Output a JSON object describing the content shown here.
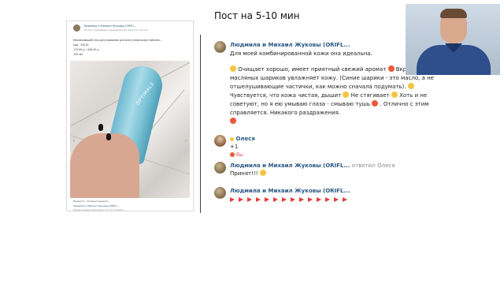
{
  "slide": {
    "title": "Пост на 5-10 мин"
  },
  "post": {
    "author": "Людмила и Михаил Жуковы (ORIFL...",
    "location": "16 ноя. | Меридиан (Свердловская область), Россия",
    "text_line1": "Увлажняющий гель для умывания для всех типов кожи Optimals...",
    "text_line2": "код - 32410",
    "text_line3": "179,90 р. / 449,00 р.",
    "text_line4": "155 зет",
    "brand": "OPTIMALS",
    "footer_line1": "Нравится · Комментировать",
    "footer_line2": "Людмила и Михаил Жуковы (ORIFL...",
    "footer_line3": "Предложение действует по 27.10.2019 г."
  },
  "comments": [
    {
      "author": "Людмила и Михаил Жуковы (ORIFL...",
      "lines": [
        "Для моей комбинированной кожи она идеальна.",
        "Очищает хорошо, имеет приятный свежий аромат",
        "масляных шариков увлажняет кожу. (Синие шарики - это масло, а не",
        "отшелушивающие частички, как можно сначала подумать).",
        "Чувствуется, что кожа чистая, дышит",
        "советуют, но я ею умываю глаза - смываю тушь",
        "справляется. Никакого раздражения."
      ],
      "line2_tail": "Вкраплен",
      "line5_tail": "Не стягивает",
      "line5_end": "Хоть и не",
      "line6_tail": ". Отлично с этим"
    },
    {
      "author": "Олеся",
      "text": "+1",
      "likes": "Вы"
    },
    {
      "author": "Людмила и Михаил Жуковы (ORIFL...",
      "reply_label": "ответил",
      "reply_to": "Олеся",
      "text": "Принят!!!"
    },
    {
      "author": "Людмила и Михаил Жуковы (ORIFL..."
    }
  ]
}
